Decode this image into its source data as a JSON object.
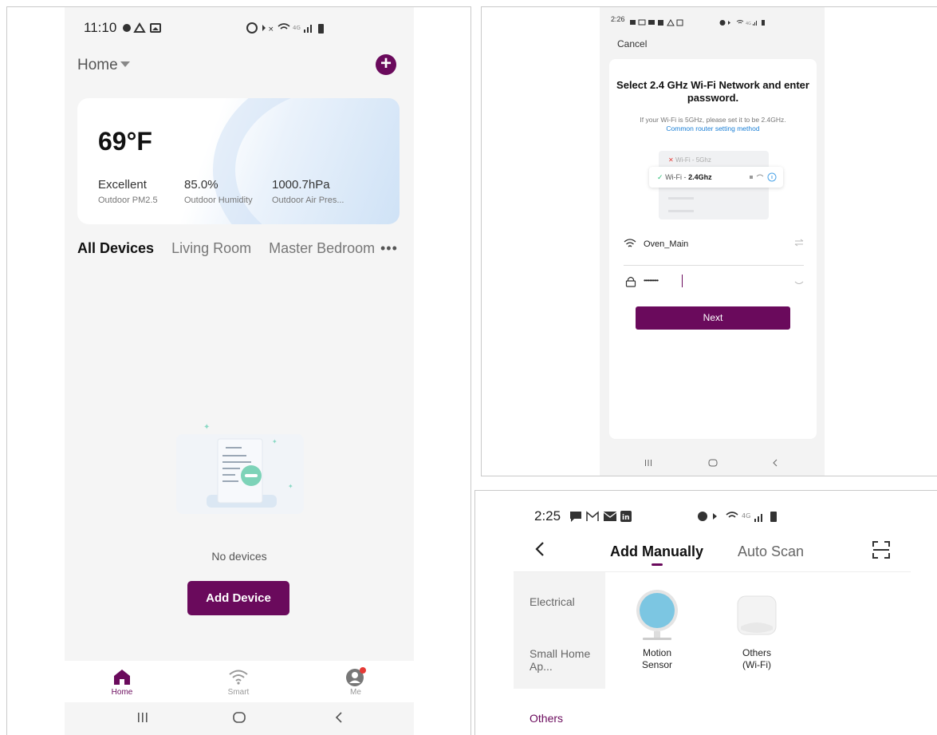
{
  "panel_home": {
    "status_time": "11:10",
    "home_label": "Home",
    "weather": {
      "temperature": "69°F",
      "stats": [
        {
          "value": "Excellent",
          "label": "Outdoor PM2.5"
        },
        {
          "value": "85.0%",
          "label": "Outdoor Humidity"
        },
        {
          "value": "1000.7hPa",
          "label": "Outdoor Air Pres..."
        }
      ]
    },
    "room_tabs": [
      "All Devices",
      "Living Room",
      "Master Bedroom"
    ],
    "more_label": "•••",
    "empty_text": "No devices",
    "add_device_label": "Add Device",
    "bottom_nav": [
      {
        "label": "Home",
        "icon": "home-icon",
        "active": true
      },
      {
        "label": "Smart",
        "icon": "wifi-icon",
        "active": false
      },
      {
        "label": "Me",
        "icon": "profile-icon",
        "active": false
      }
    ],
    "accent_color": "#6a0a5c"
  },
  "panel_wifi": {
    "status_time": "2:26",
    "cancel_label": "Cancel",
    "title": "Select 2.4 GHz Wi-Fi Network and enter password.",
    "subtitle": "If your Wi-Fi is 5GHz, please set it to be 2.4GHz.",
    "link_text": "Common router setting method",
    "illu_5g": "Wi-Fi - 5Ghz",
    "illu_24_prefix": "Wi-Fi - ",
    "illu_24_band": "2.4Ghz",
    "network_name": "Oven_Main",
    "password_mask": "••••••••••",
    "next_label": "Next"
  },
  "panel_add": {
    "status_time": "2:25",
    "tab_manual": "Add Manually",
    "tab_auto": "Auto Scan",
    "categories": [
      "Electrical",
      "Small Home Ap..."
    ],
    "others_label": "Others",
    "devices": [
      {
        "line1": "Motion",
        "line2": "Sensor"
      },
      {
        "line1": "Others",
        "line2": "(Wi-Fi)"
      }
    ]
  }
}
